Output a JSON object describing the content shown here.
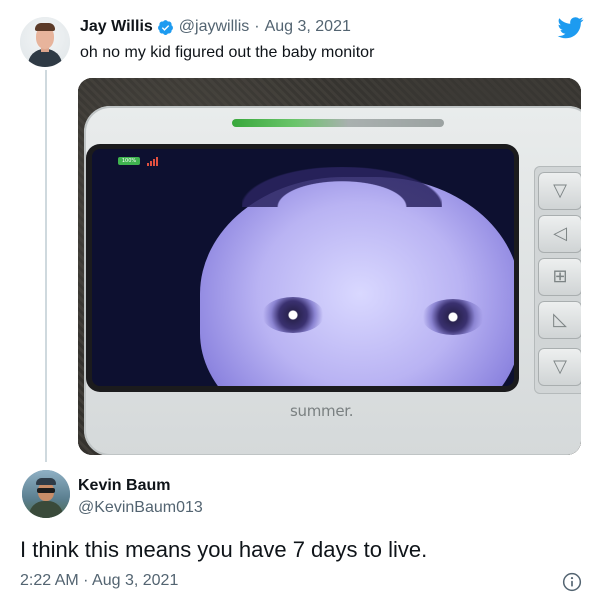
{
  "tweet": {
    "author_name": "Jay Willis",
    "author_handle": "@jaywillis",
    "separator": "·",
    "date": "Aug 3, 2021",
    "text": "oh no my kid figured out the baby monitor",
    "media": {
      "battery_label": "100%",
      "brand": "summer."
    }
  },
  "reply": {
    "author_name": "Kevin Baum",
    "author_handle": "@KevinBaum013",
    "text": "I think this means you have 7 days to live.",
    "timestamp": "2:22 AM · Aug 3, 2021"
  },
  "icons": {
    "verified": "verified-badge-icon",
    "brand_logo": "twitter-bird-icon",
    "info": "info-icon"
  },
  "colors": {
    "accent": "#1d9bf0",
    "text_primary": "#0f1419",
    "text_secondary": "#536471"
  }
}
